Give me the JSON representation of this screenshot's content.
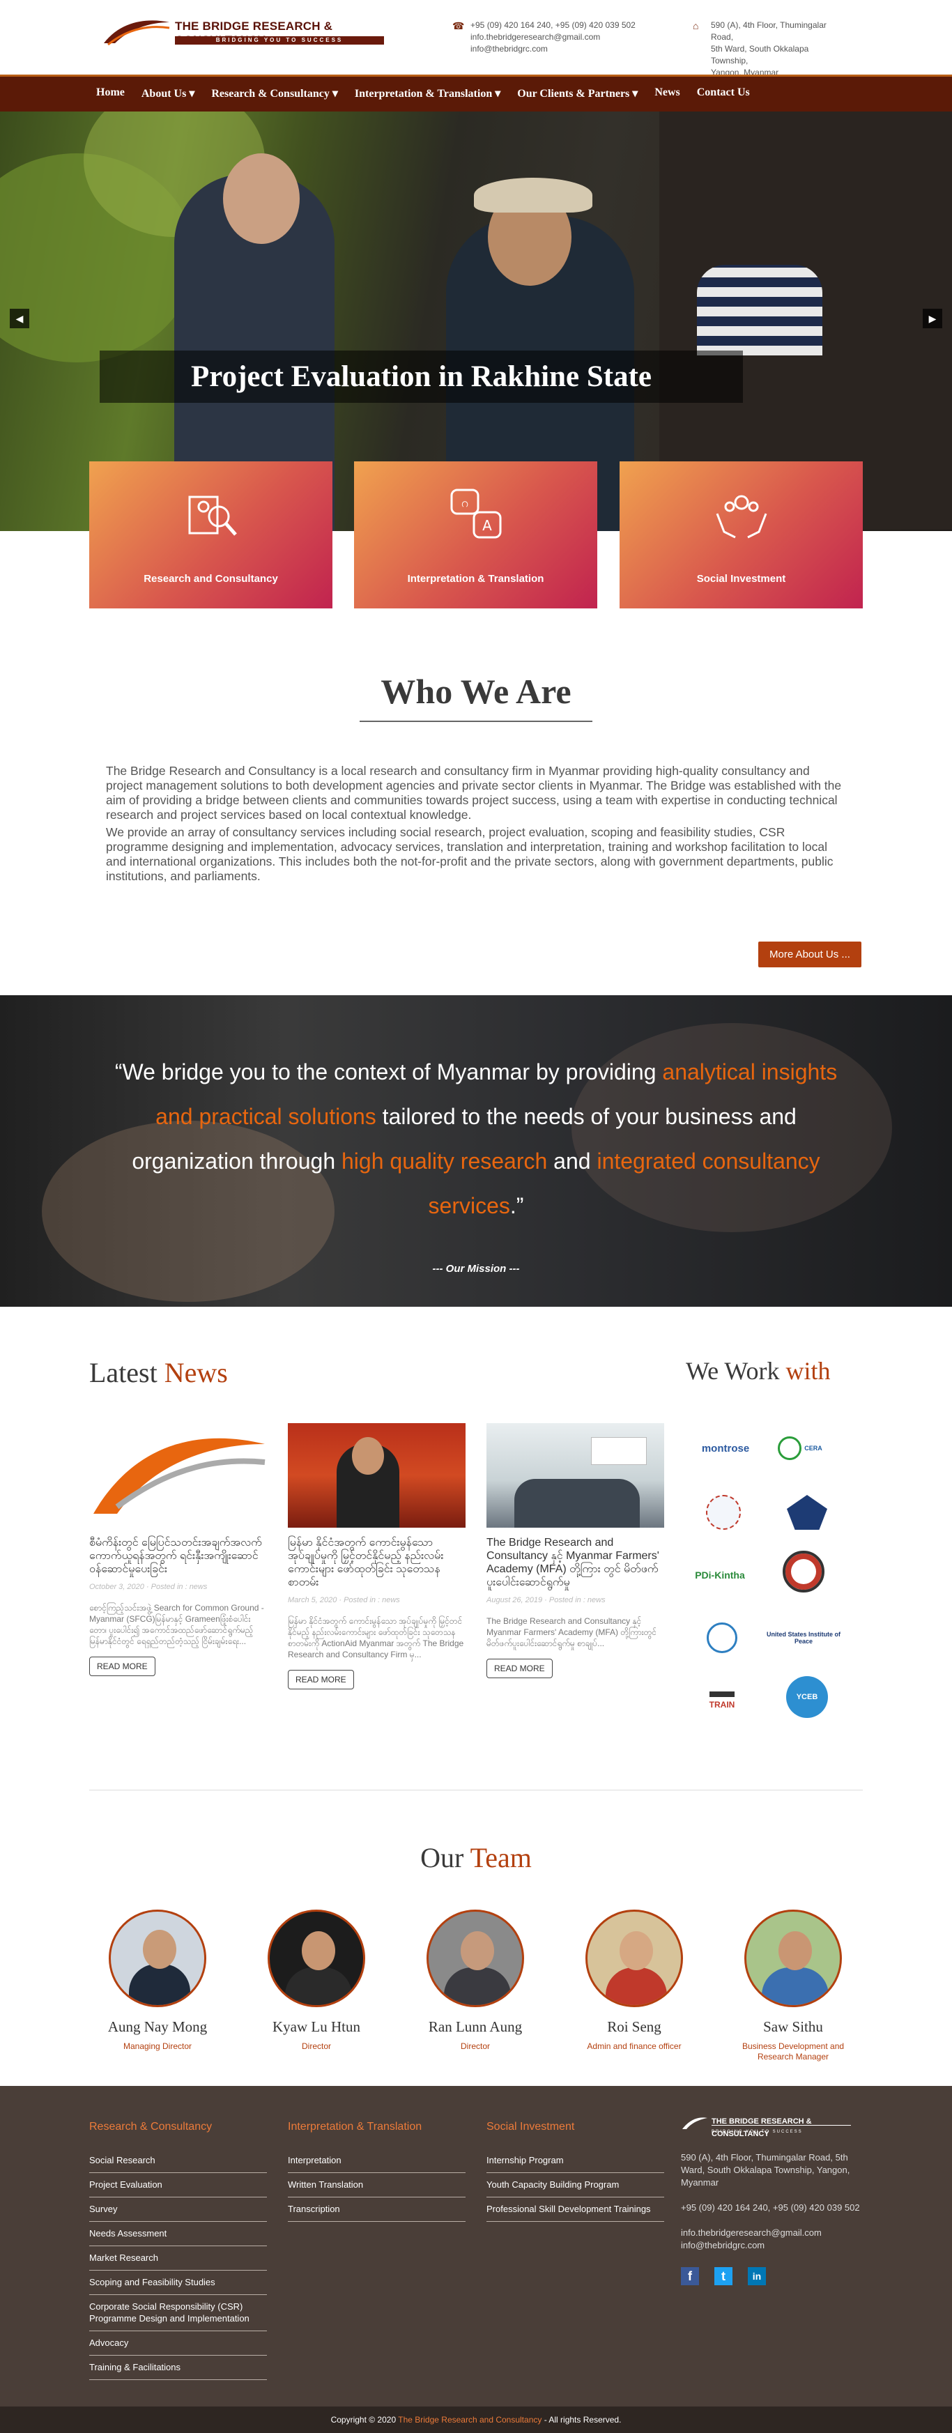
{
  "header": {
    "brand": "THE BRIDGE RESEARCH & CONSULTANCY",
    "tagline": "BRIDGING YOU TO SUCCESS",
    "phones": "+95 (09) 420 164 240, +95 (09) 420 039 502",
    "email1": "info.thebridgeresearch@gmail.com",
    "email2": "info@thebridgrc.com",
    "addr1": "590 (A), 4th Floor, Thumingalar Road,",
    "addr2": "5th Ward, South Okkalapa Township,",
    "addr3": "Yangon, Myanmar"
  },
  "nav": [
    "Home",
    "About Us ▾",
    "Research & Consultancy ▾",
    "Interpretation & Translation ▾",
    "Our Clients & Partners ▾",
    "News",
    "Contact Us"
  ],
  "hero": {
    "caption": "Project Evaluation in Rakhine State",
    "prev": "◀",
    "next": "▶"
  },
  "services": [
    "Research and Consultancy",
    "Interpretation & Translation",
    "Social Investment"
  ],
  "who": {
    "title": "Who We Are",
    "p1": "The Bridge Research and Consultancy is a local research and consultancy firm in Myanmar providing high-quality consultancy and project management solutions to both development agencies and private sector clients in Myanmar. The Bridge was established with the aim of providing a bridge between clients and communities towards project success, using a team with expertise in conducting technical research and project services based on local contextual knowledge.",
    "p2": "We provide an array of consultancy services including social research, project evaluation, scoping and feasibility studies, CSR programme designing and implementation, advocacy services, translation and interpretation, training and workshop facilitation to local and international organizations. This includes both the not-for-profit and the private sectors, along with government departments, public institutions, and parliaments.",
    "button": "More About Us ..."
  },
  "mission": {
    "q1": "“We bridge you to the context of Myanmar by providing ",
    "h1": "analytical insights and practical solutions",
    "q2": " tailored to the needs of your business and organization through ",
    "h2": "high quality research",
    "q3": " and ",
    "h3": "integrated consultancy services",
    "q4": ".”",
    "sig": "--- Our Mission ---"
  },
  "news": {
    "title_a": "Latest ",
    "title_b": "News",
    "items": [
      {
        "title": "စီမံကိန်းတွင် မြေပြင်သတင်းအချက်အလက်ကောက်ယူရန်အတွက် ရင်းနှီးအကျိုးဆောင်ဝန်ဆောင်မှုပေးခြင်း",
        "meta": "October 3, 2020 · Posted in : news",
        "excerpt": "စောင့်ကြည့်သင်းအဖွဲ့ Search for Common Ground -Myanmar (SFCG)မြန်မာနှင့် Grameenဖြုံးစံပေါင်းတော၊ ပူးပေါင်း၍ အကောင်အထည်ဖော်ဆောင်ရွက်မည့် မြန်မာနိုင်ငံတွင် ရေရှည်တည်တံ့သည့် ငြိမ်းချမ်းရေး...",
        "button": "READ MORE"
      },
      {
        "title": "မြန်မာ နိုင်ငံအတွက် ကောင်းမွန်သော အုပ်ချုပ်မှုကို မြှင့်တင်နိုင်မည့် နည်းလမ်းကောင်းများ ဖော်ထုတ်ခြင်း သုတေသနစာတမ်း",
        "meta": "March 5, 2020 · Posted in : news",
        "excerpt": "မြန်မာ နိုင်ငံအတွက် ကောင်းမွန်သော အုပ်ချုပ်မှုကို မြှင့်တင်နိုင်မည့် နည်းလမ်းကောင်းများ ဖော်ထုတ်ခြင်း သုတေသနစာတမ်းကို ActionAid Myanmar အတွက် The Bridge Research and Consultancy Firm မှ...",
        "button": "READ MORE"
      },
      {
        "title": "The Bridge Research and Consultancy နှင့် Myanmar Farmers' Academy (MFA) တို့ကြား တွင် မိတ်ဖက်ပူးပေါင်းဆောင်ရွက်မှု",
        "meta": "August 26, 2019 · Posted in : news",
        "excerpt": "The Bridge Research and Consultancy နှင့် Myanmar Farmers' Academy (MFA) တို့ကြားတွင် မိတ်ဖက်ပူးပေါင်းဆောင်ရွက်မှု စာချုပ်...",
        "button": "READ MORE"
      }
    ]
  },
  "partners": {
    "title_a": "We Work ",
    "title_b": "with",
    "names": [
      "montrose",
      "CERA",
      "",
      "",
      "PDi-Kintha",
      "",
      "",
      "United States Institute of Peace",
      "TRAIN",
      "YCEB"
    ]
  },
  "team": {
    "title_a": "Our ",
    "title_b": "Team",
    "members": [
      {
        "name": "Aung Nay Mong",
        "role": "Managing Director"
      },
      {
        "name": "Kyaw Lu Htun",
        "role": "Director"
      },
      {
        "name": "Ran Lunn Aung",
        "role": "Director"
      },
      {
        "name": "Roi Seng",
        "role": "Admin and finance officer"
      },
      {
        "name": "Saw Sithu",
        "role": "Business Development and Research Manager"
      }
    ]
  },
  "footer": {
    "col1": {
      "title": "Research & Consultancy",
      "items": [
        "Social Research",
        "Project Evaluation",
        "Survey",
        "Needs Assessment",
        "Market Research",
        "Scoping and Feasibility Studies",
        "Corporate Social Responsibility (CSR) Programme Design and Implementation",
        "Advocacy",
        "Training & Facilitations"
      ]
    },
    "col2": {
      "title": "Interpretation & Translation",
      "items": [
        "Interpretation",
        "Written Translation",
        "Transcription"
      ]
    },
    "col3": {
      "title": "Social Investment",
      "items": [
        "Internship Program",
        "Youth Capacity Building Program",
        "Professional Skill Development Trainings"
      ]
    },
    "brand": "THE BRIDGE RESEARCH & CONSULTANCY",
    "tagline": "BRIDGING YOU TO SUCCESS",
    "address": "590 (A), 4th Floor, Thumingalar Road, 5th Ward, South Okkalapa Township, Yangon, Myanmar",
    "phones": "+95 (09) 420 164 240, +95 (09) 420 039 502",
    "email1": "info.thebridgeresearch@gmail.com",
    "email2": "info@thebridgrc.com",
    "copy_a": "Copyright © 2020 ",
    "copy_b": "The Bridge Research and Consultancy",
    "copy_c": " - All rights Reserved."
  },
  "colors": {
    "brand": "#5b1a07",
    "accent": "#b3400f",
    "orange": "#e8660f"
  }
}
